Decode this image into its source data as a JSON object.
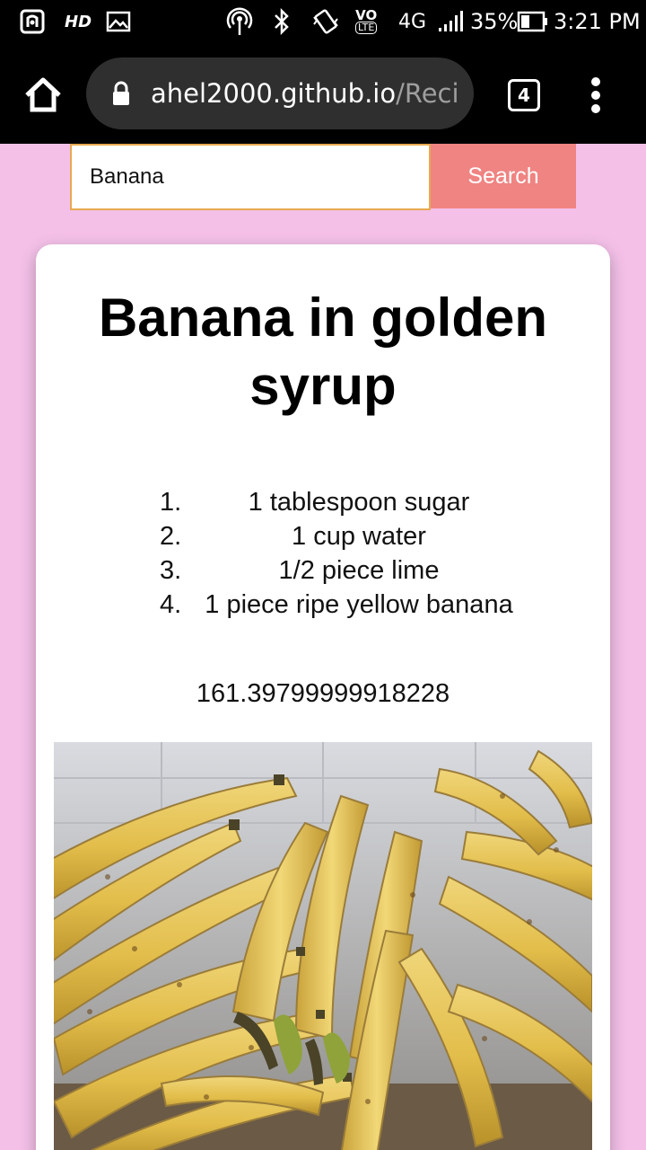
{
  "status_bar": {
    "hd_label": "HD",
    "network_label": "4G",
    "volte_label": "VO",
    "lte_label": "LTE",
    "battery": "35%",
    "time": "3:21 PM",
    "icons": [
      "nfc-icon",
      "image-icon",
      "hotspot-icon",
      "bluetooth-icon",
      "vibrate-icon",
      "signal-icon",
      "battery-icon"
    ]
  },
  "browser": {
    "url_host": "ahel2000.github.io",
    "url_path": "/Reci",
    "tab_count": "4",
    "icons": [
      "home-icon",
      "lock-icon",
      "more-vert-icon"
    ]
  },
  "search": {
    "value": "Banana",
    "button_label": "Search"
  },
  "recipe": {
    "title": "Banana in golden syrup",
    "ingredients": [
      {
        "num": "1.",
        "text": "1 tablespoon sugar"
      },
      {
        "num": "2.",
        "text": "1 cup water"
      },
      {
        "num": "3.",
        "text": "1/2 piece lime"
      },
      {
        "num": "4.",
        "text": "1 piece ripe yellow banana"
      }
    ],
    "calories": "161.39799999918228"
  },
  "colors": {
    "page_bg": "#f4c0e8",
    "search_button": "#ef8482",
    "input_border": "#e8a94f",
    "card_bg": "#ffffff"
  }
}
